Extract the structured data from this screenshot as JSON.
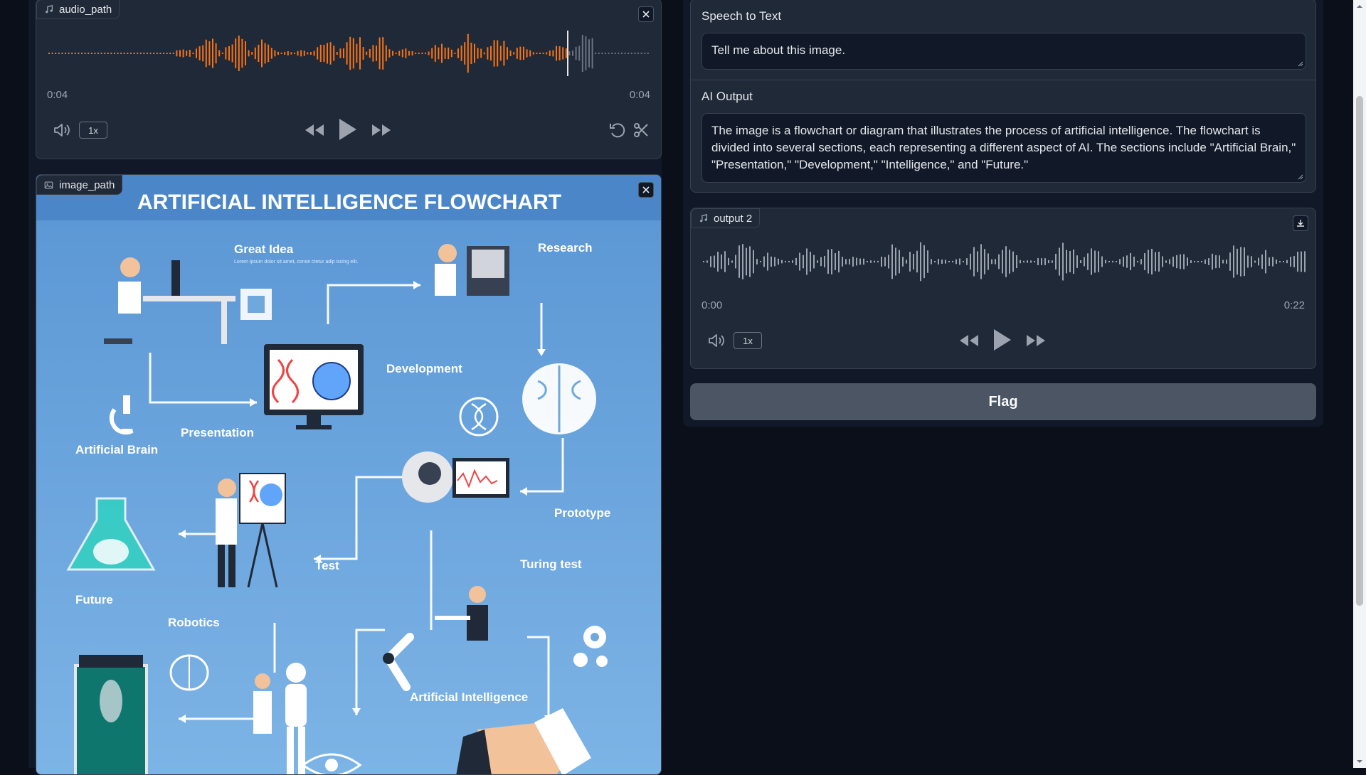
{
  "audio_input": {
    "label": "audio_path",
    "current_time": "0:04",
    "duration": "0:04",
    "playback_rate": "1x",
    "waveform_color": "#f97316",
    "progress": 0.86
  },
  "image_input": {
    "label": "image_path",
    "infographic": {
      "title": "ARTIFICIAL INTELLIGENCE FLOWCHART",
      "sections": [
        "Great Idea",
        "Research",
        "Development",
        "Presentation",
        "Artificial Brain",
        "Prototype",
        "Test",
        "Turing test",
        "Future",
        "Robotics",
        "Artificial Intelligence"
      ],
      "filler_text": "Lorem ipsum dolor sit amet, conse ctetur adip iscing elit."
    }
  },
  "speech_to_text": {
    "label": "Speech to Text",
    "value": "Tell me about this image."
  },
  "ai_output": {
    "label": "AI Output",
    "value": "The image is a flowchart or diagram that illustrates the process of artificial intelligence. The flowchart is divided into several sections, each representing a different aspect of AI. The sections include \"Artificial Brain,\" \"Presentation,\" \"Development,\" \"Intelligence,\" and \"Future.\""
  },
  "audio_output": {
    "label": "output 2",
    "current_time": "0:00",
    "duration": "0:22",
    "playback_rate": "1x",
    "waveform_color": "#9ca3af"
  },
  "flag_button": {
    "label": "Flag"
  },
  "icons": [
    "music-note-icon",
    "image-icon",
    "close-icon",
    "volume-icon",
    "rewind-icon",
    "play-icon",
    "fast-forward-icon",
    "undo-icon",
    "scissors-icon",
    "download-icon"
  ]
}
